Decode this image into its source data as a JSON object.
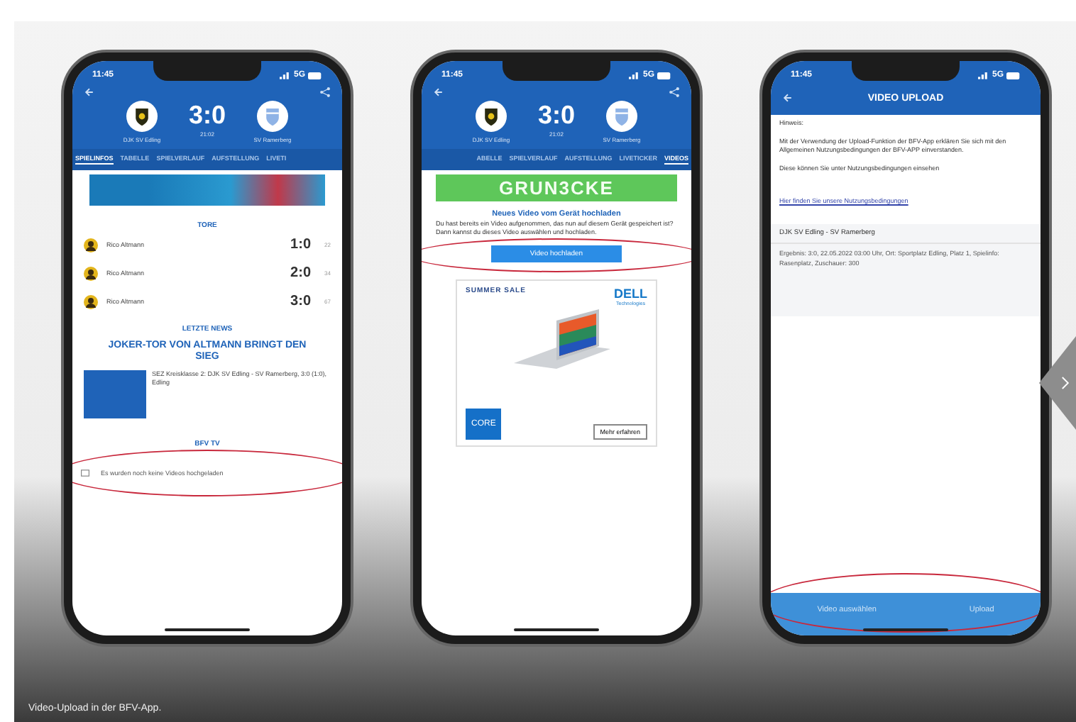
{
  "slide": {
    "caption": "Video-Upload in der BFV-App."
  },
  "phones": [
    {
      "kind": "match",
      "status_time": "11:45",
      "network": "5G",
      "home_team": "DJK SV Edling",
      "away_team": "SV Ramerberg",
      "score": "3:0",
      "match_time": "21:02",
      "tabs": [
        {
          "label": "SPIELINFOS",
          "selected": true
        },
        {
          "label": "TABELLE",
          "selected": false
        },
        {
          "label": "SPIELVERLAUF",
          "selected": false
        },
        {
          "label": "AUFSTELLUNG",
          "selected": false
        },
        {
          "label": "LIVETI",
          "selected": false
        }
      ],
      "goals_heading": "TORE",
      "goals": [
        {
          "scorer": "Rico Altmann",
          "score": "1:0",
          "minute": "22"
        },
        {
          "scorer": "Rico Altmann",
          "score": "2:0",
          "minute": "34"
        },
        {
          "scorer": "Rico Altmann",
          "score": "3:0",
          "minute": "67"
        }
      ],
      "news_heading": "LETZTE NEWS",
      "news_headline": "JOKER-TOR VON ALTMANN BRINGT DEN SIEG",
      "news_text": "SEZ Kreisklasse 2: DJK SV Edling - SV Ramerberg, 3:0 (1:0), Edling",
      "tv_heading": "BFV TV",
      "tv_empty": "Es wurden noch keine Videos hochgeladen"
    },
    {
      "kind": "videos",
      "status_time": "11:45",
      "network": "5G",
      "home_team": "DJK SV Edling",
      "away_team": "SV Ramerberg",
      "score": "3:0",
      "match_time": "21:02",
      "tabs": [
        {
          "label": "ABELLE",
          "selected": false
        },
        {
          "label": "SPIELVERLAUF",
          "selected": false
        },
        {
          "label": "AUFSTELLUNG",
          "selected": false
        },
        {
          "label": "LIVETICKER",
          "selected": false
        },
        {
          "label": "VIDEOS",
          "selected": true
        }
      ],
      "sponsor": "GRUN3CKE",
      "upload_title": "Neues Video vom Gerät hochladen",
      "upload_text": "Du hast bereits ein Video aufgenommen, das nun auf diesem Gerät gespeichert ist? Dann kannst du dieses Video auswählen und hochladen.",
      "upload_button": "Video hochladen",
      "ad": {
        "headline": "SUMMER SALE",
        "brand": "DELL",
        "brand_sub": "Technologies",
        "chip": "CORE",
        "button": "Mehr erfahren"
      }
    },
    {
      "kind": "upload",
      "status_time": "11:45",
      "network": "5G",
      "title": "VIDEO UPLOAD",
      "note_label": "Hinweis:",
      "note_text": "Mit der Verwendung der Upload-Funktion der BFV-App erklären Sie sich mit den Allgemeinen Nutzungsbedingungen der BFV-APP einverstanden.",
      "note_more": "Diese können Sie unter Nutzungsbedingungen einsehen",
      "terms_link": "Hier finden Sie unsere Nutzungsbedingungen",
      "match_title": "DJK SV Edling - SV Ramerberg",
      "match_details": "Ergebnis: 3:0, 22.05.2022 03:00 Uhr, Ort: Sportplatz Edling, Platz 1, Spielinfo: Rasenplatz, Zuschauer: 300",
      "buttons": [
        "Video auswählen",
        "Upload"
      ]
    }
  ]
}
